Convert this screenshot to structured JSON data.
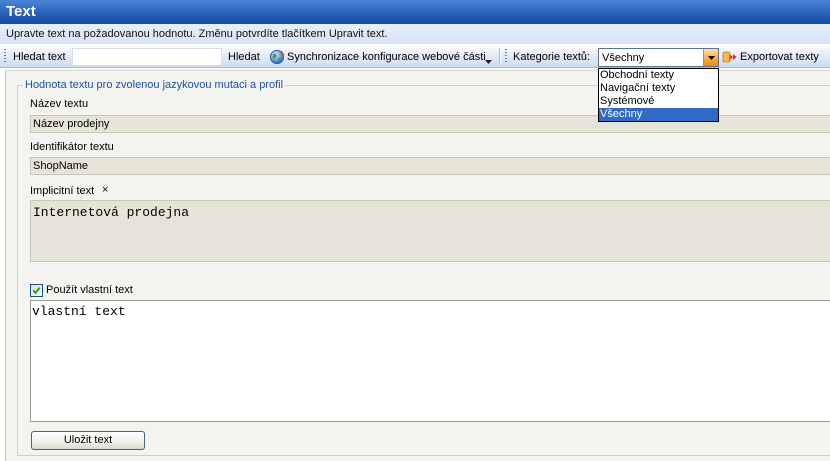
{
  "window": {
    "title": "Text"
  },
  "info": {
    "message": "Upravte text na požadovanou hodnotu. Změnu potvrdíte tlačítkem Upravit text."
  },
  "toolbar": {
    "search_label": "Hledat text",
    "search_button": "Hledat",
    "sync_label": "Synchronizace konfigurace webové části",
    "category_label": "Kategorie textů:",
    "category_selected": "Všechny",
    "category_options": [
      "Obchodní texty",
      "Navigační texty",
      "Systémové",
      "Všechny"
    ],
    "export_label": "Exportovat texty"
  },
  "form": {
    "legend": "Hodnota textu pro zvolenou jazykovou mutaci a profil",
    "name_label": "Název textu",
    "name_value": "Název prodejny",
    "id_label": "Identifikátor textu",
    "id_value": "ShopName",
    "default_label": "Implicitní text",
    "default_marker": "×",
    "default_value": "Internetová prodejna",
    "custom_checkbox_label": "Použít vlastní text",
    "custom_checkbox_checked": true,
    "custom_value": "vlastní text",
    "save_button": "Uložit text"
  },
  "icons": {
    "sync": "sync-globe-icon",
    "sync_menu": "chevron-down-icon",
    "select_toggle": "dropdown-arrow-icon",
    "export": "export-icon",
    "checkbox": "check-icon",
    "grip": "toolbar-grip-icon"
  },
  "colors": {
    "title_bar": "#2158b0",
    "legend_text": "#1c4f9c",
    "selected_option": "#316ac5",
    "readonly_field": "#e6e3d8",
    "dropdown_button": "#f5a93a",
    "check_mark": "#21a121"
  }
}
